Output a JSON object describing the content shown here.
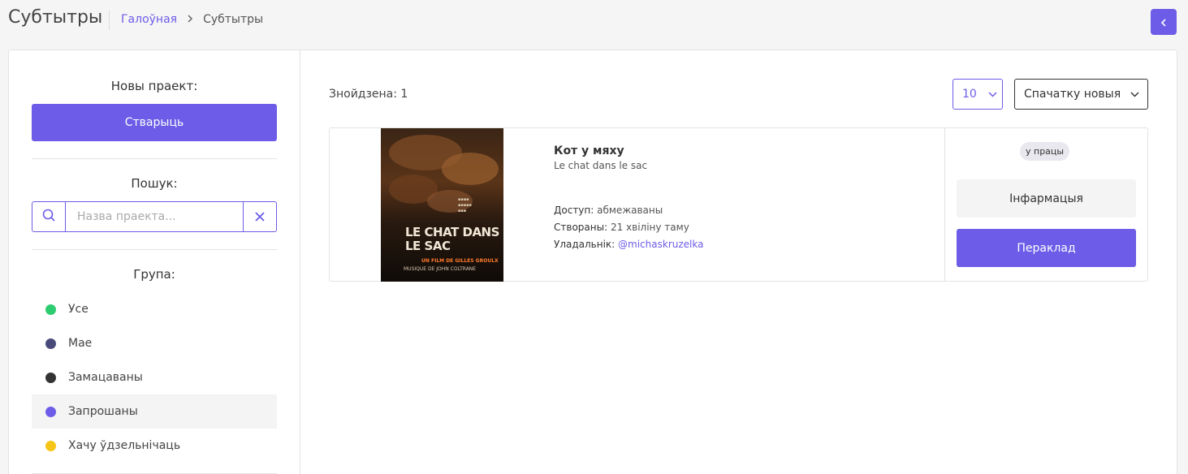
{
  "header": {
    "title": "Субтытры",
    "breadcrumb": {
      "home": "Галоўная",
      "current": "Субтытры"
    }
  },
  "sidebar": {
    "new_project_label": "Новы праект:",
    "create_button": "Стварыць",
    "search_label": "Пошук:",
    "search_placeholder": "Назва праекта...",
    "group_label": "Група:",
    "groups": [
      {
        "label": "Усе",
        "color": "#2ecc71"
      },
      {
        "label": "Мае",
        "color": "#4a4a7a"
      },
      {
        "label": "Замацаваны",
        "color": "#333333"
      },
      {
        "label": "Запрошаны",
        "color": "#6c5ce7"
      },
      {
        "label": "Хачу ўдзельнічаць",
        "color": "#f5c518"
      }
    ],
    "active_group": "Запрошаны"
  },
  "main": {
    "found": "Знойдзена: 1",
    "per_page": "10",
    "sort": "Спачатку новыя",
    "projects": [
      {
        "title": "Кот у мяху",
        "original_title": "Le chat dans le sac",
        "poster_title": "LE CHAT DANS LE SAC",
        "poster_subtitle": "UN FILM DE GILLES GROULX",
        "poster_music": "MUSIQUE DE JOHN COLTRANE",
        "access_label": "Доступ:",
        "access_value": "абмежаваны",
        "created_label": "Створаны:",
        "created_value": "21 хвіліну таму",
        "owner_label": "Уладальнік:",
        "owner_value": "@michaskruzelka",
        "status": "у працы",
        "info_button": "Інфармацыя",
        "translate_button": "Пераклад"
      }
    ]
  },
  "colors": {
    "accent": "#6c5ce7"
  }
}
